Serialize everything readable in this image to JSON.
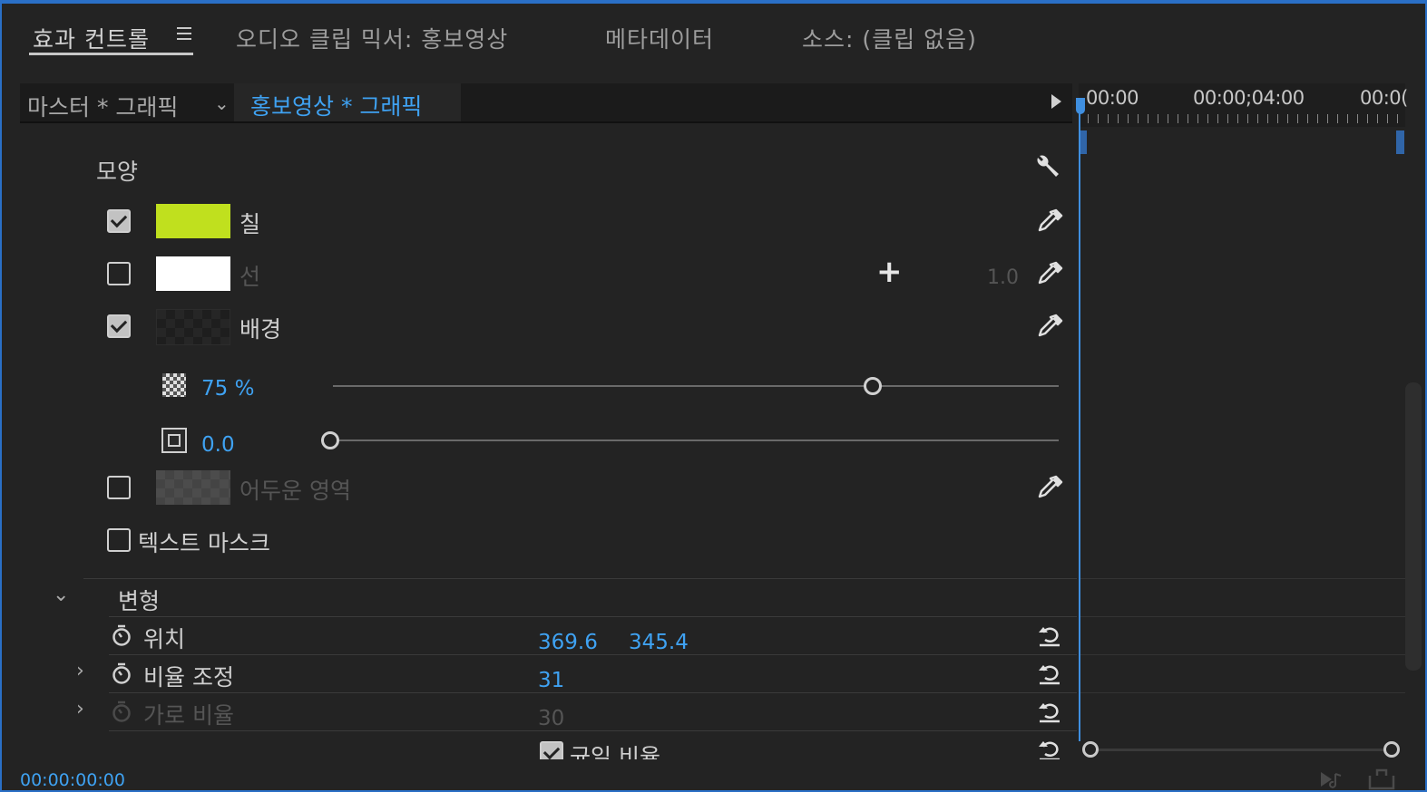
{
  "tabs": [
    {
      "label": "효과 컨트롤",
      "active": true
    },
    {
      "label": "오디오 클립 믹서: 홍보영상",
      "active": false
    },
    {
      "label": "메타데이터",
      "active": false
    },
    {
      "label": "소스: (클립 없음)",
      "active": false
    }
  ],
  "clip_bar": {
    "master_label": "마스터 * 그래픽",
    "sequence_label": "홍보영상 * 그래픽"
  },
  "timeline": {
    "times": [
      "00:00",
      "00:00;04:00",
      "00:0("
    ]
  },
  "shape_section": {
    "title": "모양",
    "fill": {
      "label": "칠",
      "checked": true,
      "color": "#c0e01e"
    },
    "stroke": {
      "label": "선",
      "checked": false,
      "color": "#ffffff",
      "width": "1.0"
    },
    "background": {
      "label": "배경",
      "checked": true
    },
    "bg_opacity": {
      "value": "75 %",
      "level": 0.75
    },
    "bg_size": {
      "value": "0.0",
      "level": 0.0
    },
    "shadow": {
      "label": "어두운 영역",
      "checked": false
    },
    "text_mask": {
      "label": "텍스트 마스크",
      "checked": false
    }
  },
  "transform": {
    "title": "변형",
    "position": {
      "label": "위치",
      "x": "369.6",
      "y": "345.4"
    },
    "scale": {
      "label": "비율 조정",
      "value": "31"
    },
    "scale_width": {
      "label": "가로 비율",
      "value": "30"
    },
    "uniform": {
      "label": "균일 비율",
      "checked": true
    }
  },
  "footer": {
    "timecode": "00:00:00:00"
  },
  "colors": {
    "accent": "#3fa2f2",
    "panel_bg": "#232323",
    "border": "#2a6fc6"
  }
}
